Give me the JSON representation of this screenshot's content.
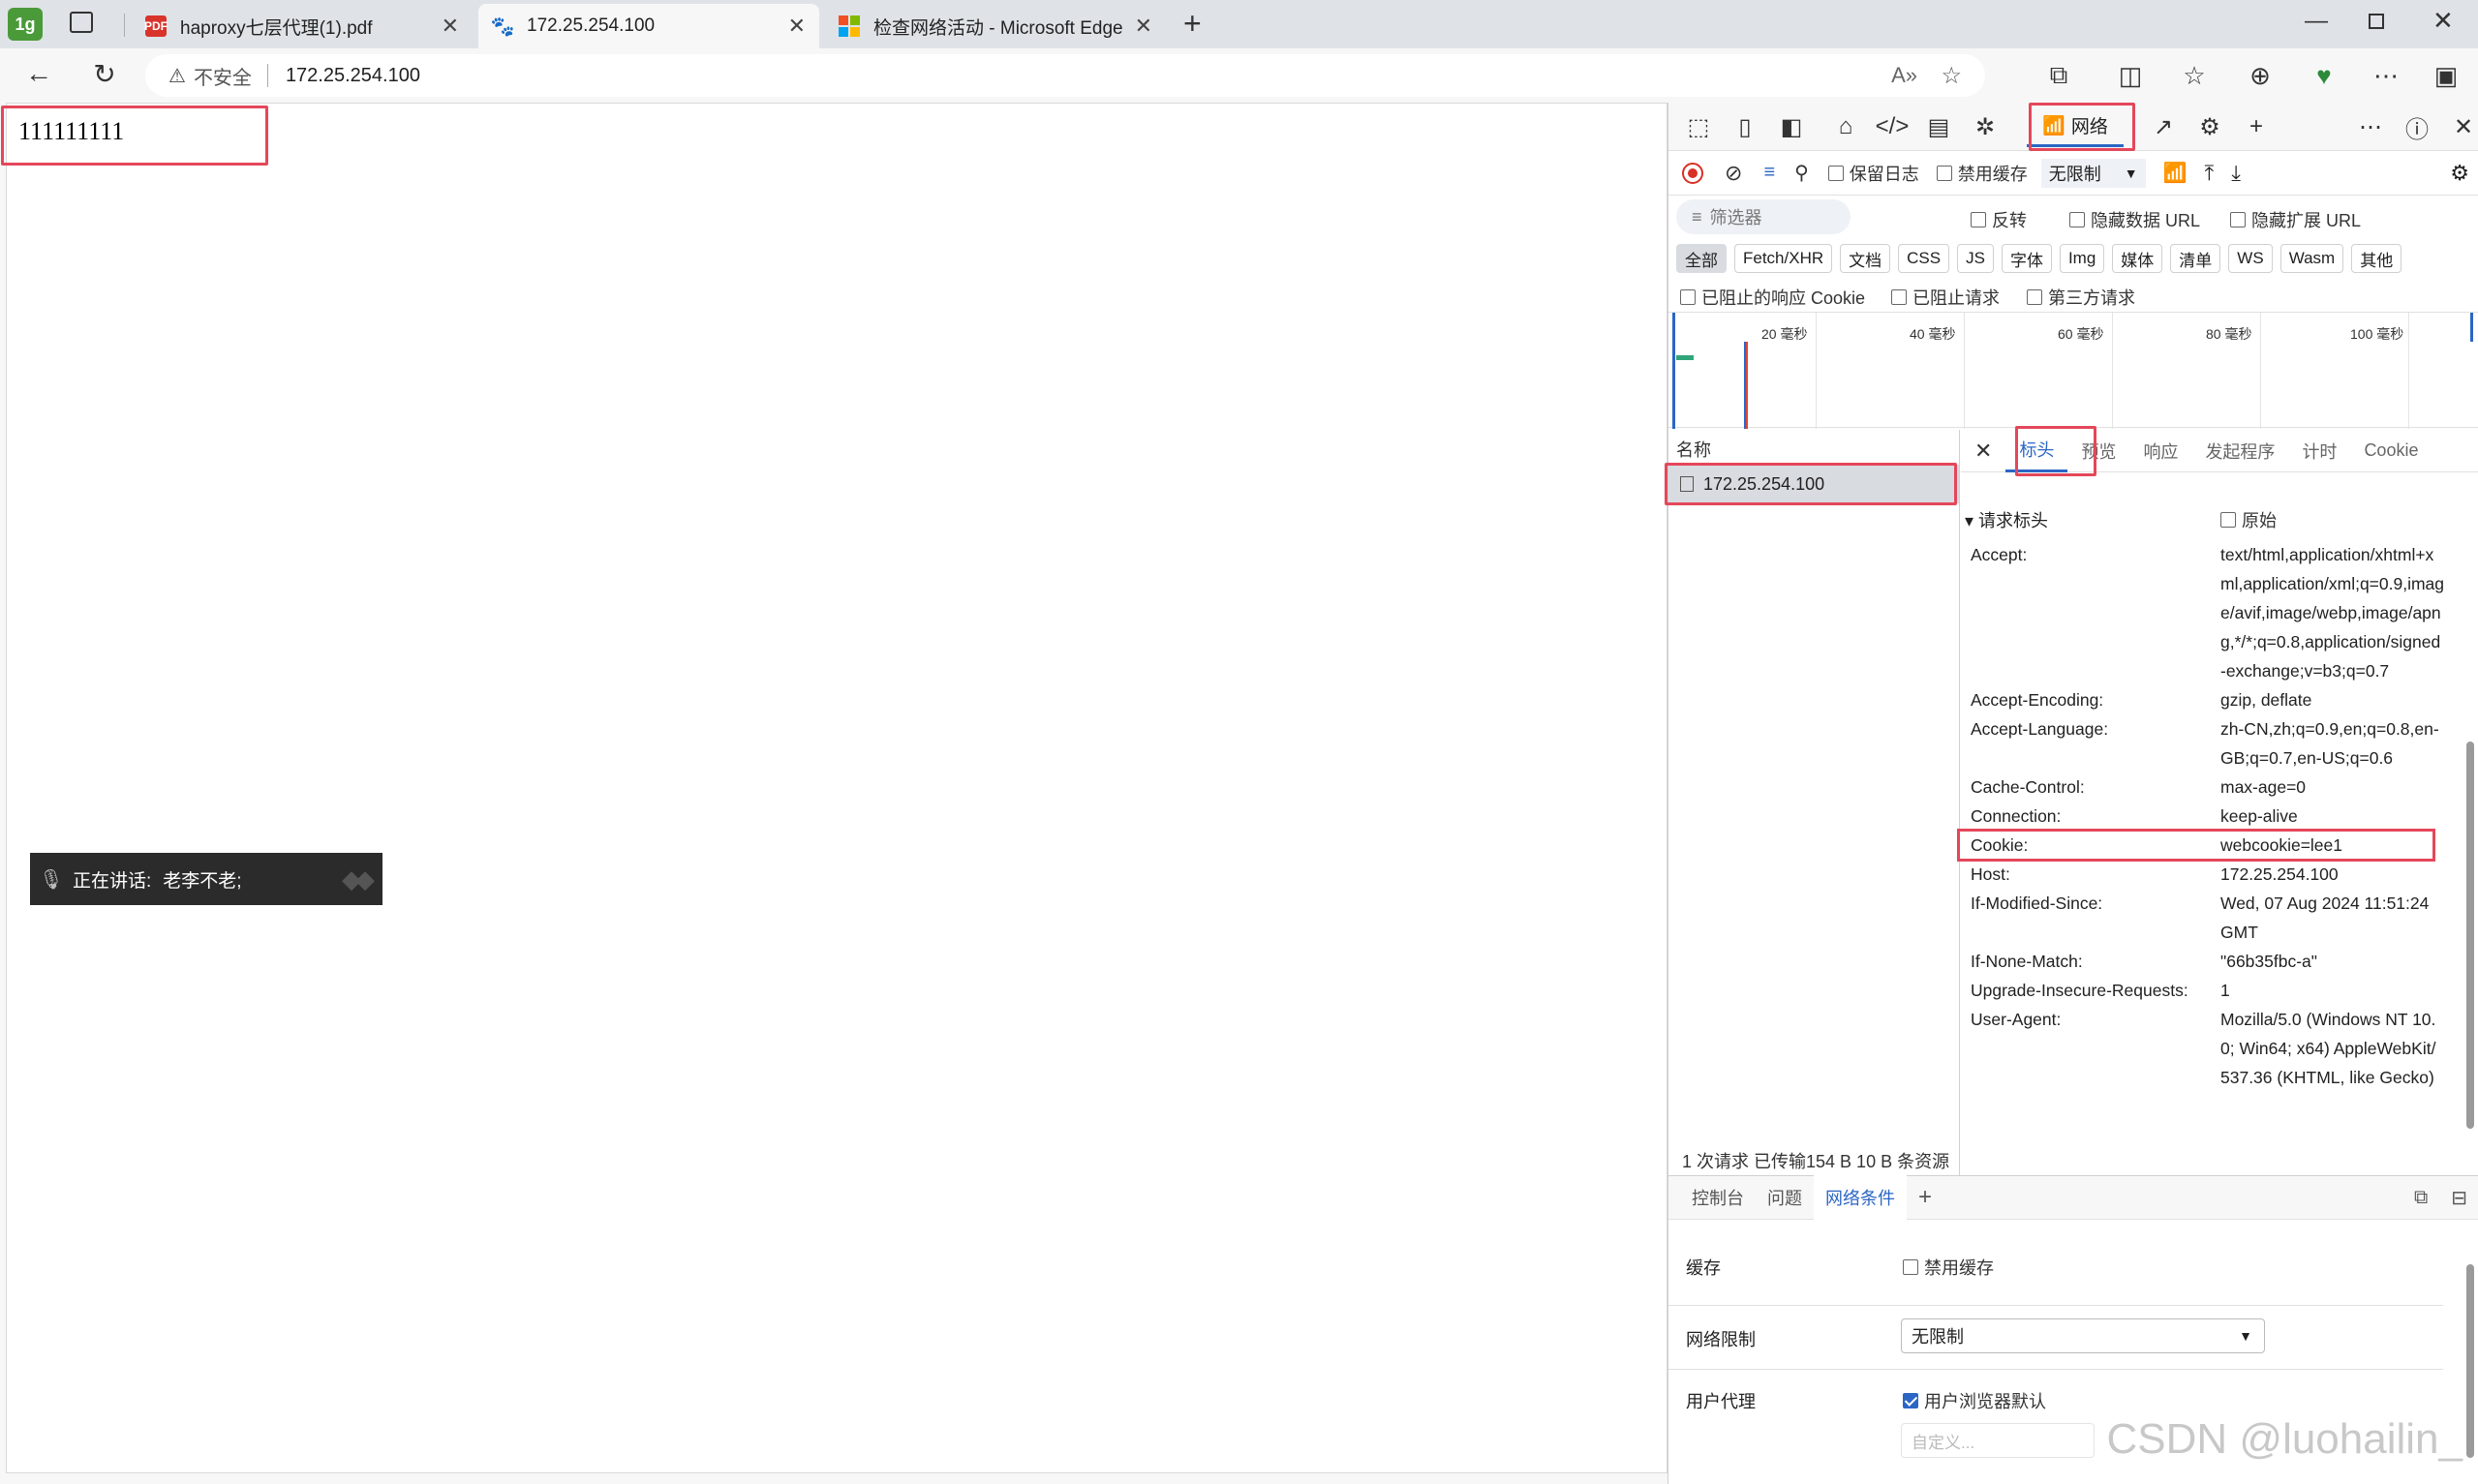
{
  "browser": {
    "tabs": [
      {
        "title": "haproxy七层代理(1).pdf",
        "icon": "pdf-icon"
      },
      {
        "title": "172.25.254.100",
        "icon": "paw-icon"
      },
      {
        "title": "检查网络活动 - Microsoft Edge D",
        "icon": "microsoft-icon"
      }
    ],
    "new_tab": "+",
    "security_label": "不安全",
    "url": "172.25.254.100"
  },
  "page": {
    "body_text": "111111111",
    "speaking_label": "正在讲话:",
    "speaker_name": "老李不老;"
  },
  "devtools": {
    "network_tab_label": "网络",
    "preserve_log": "保留日志",
    "disable_cache": "禁用缓存",
    "throttle": "无限制",
    "filter_placeholder": "筛选器",
    "invert": "反转",
    "hide_data_url": "隐藏数据 URL",
    "hide_ext_url": "隐藏扩展 URL",
    "type_chips": [
      "全部",
      "Fetch/XHR",
      "文档",
      "CSS",
      "JS",
      "字体",
      "Img",
      "媒体",
      "清单",
      "WS",
      "Wasm",
      "其他"
    ],
    "blocked_cookies": "已阻止的响应 Cookie",
    "blocked_requests": "已阻止请求",
    "third_party": "第三方请求",
    "timeline_ticks": [
      "20 毫秒",
      "40 毫秒",
      "60 毫秒",
      "80 毫秒",
      "100 毫秒"
    ],
    "name_header": "名称",
    "request_name": "172.25.254.100",
    "summary": "1 次请求  已传输154 B  10 B 条资源",
    "detail_tabs": [
      "标头",
      "预览",
      "响应",
      "发起程序",
      "计时",
      "Cookie"
    ],
    "request_headers_title": "▾ 请求标头",
    "raw_label": "原始",
    "headers": [
      {
        "k": "Accept:",
        "v": "text/html,application/xhtml+xml,application/xml;q=0.9,image/avif,image/webp,image/apng,*/*;q=0.8,application/signed-exchange;v=b3;q=0.7"
      },
      {
        "k": "Accept-Encoding:",
        "v": "gzip, deflate"
      },
      {
        "k": "Accept-Language:",
        "v": "zh-CN,zh;q=0.9,en;q=0.8,en-GB;q=0.7,en-US;q=0.6"
      },
      {
        "k": "Cache-Control:",
        "v": "max-age=0"
      },
      {
        "k": "Connection:",
        "v": "keep-alive"
      },
      {
        "k": "Cookie:",
        "v": "webcookie=lee1"
      },
      {
        "k": "Host:",
        "v": "172.25.254.100"
      },
      {
        "k": "If-Modified-Since:",
        "v": "Wed, 07 Aug 2024 11:51:24 GMT"
      },
      {
        "k": "If-None-Match:",
        "v": "\"66b35fbc-a\""
      },
      {
        "k": "Upgrade-Insecure-Requests:",
        "v": "1"
      },
      {
        "k": "User-Agent:",
        "v": "Mozilla/5.0 (Windows NT 10.0; Win64; x64) AppleWebKit/537.36 (KHTML, like Gecko)"
      }
    ],
    "bottom_tabs": [
      "控制台",
      "问题",
      "网络条件"
    ],
    "nc_cache_label": "缓存",
    "nc_disable_cache": "禁用缓存",
    "nc_throttle_label": "网络限制",
    "nc_throttle_value": "无限制",
    "nc_ua_label": "用户代理",
    "nc_ua_default": "用户浏览器默认",
    "nc_custom_placeholder": "自定义..."
  },
  "watermark": "CSDN @luohailin_"
}
